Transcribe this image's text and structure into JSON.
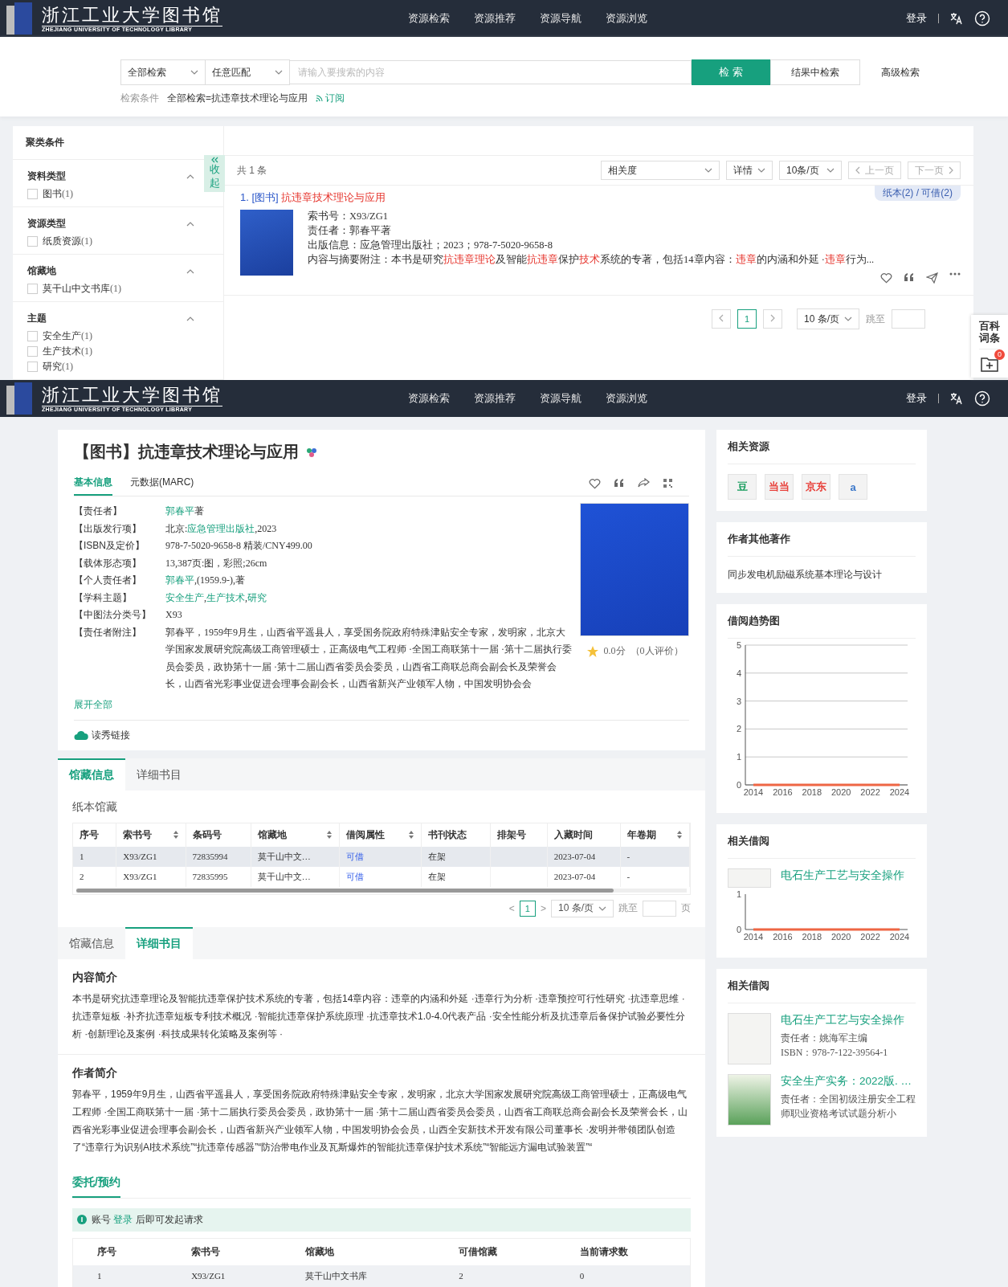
{
  "search_page": {
    "header": {
      "logo_title": "浙江工业大学图书馆",
      "logo_subtitle": "ZHEJIANG UNIVERSITY OF TECHNOLOGY LIBRARY",
      "nav": [
        "资源检索",
        "资源推荐",
        "资源导航",
        "资源浏览"
      ],
      "login": "登录"
    },
    "search": {
      "scope": "全部检索",
      "match": "任意匹配",
      "placeholder": "请输入要搜索的内容",
      "search_button": "检 索",
      "refine_button": "结果中检索",
      "advanced": "高级检索",
      "condition_label": "检索条件",
      "condition": "全部检索=抗违章技术理论与应用",
      "subscribe": "订阅"
    },
    "facets": {
      "title": "聚类条件",
      "collapse": "收起",
      "groups": [
        {
          "title": "资料类型",
          "expanded": true,
          "items": [
            {
              "label": "图书",
              "count": "(1)",
              "checked": false
            }
          ]
        },
        {
          "title": "资源类型",
          "expanded": true,
          "items": [
            {
              "label": "纸质资源",
              "count": "(1)",
              "checked": false
            }
          ]
        },
        {
          "title": "馆藏地",
          "expanded": true,
          "items": [
            {
              "label": "莫干山中文书库",
              "count": "(1)",
              "checked": false
            }
          ]
        },
        {
          "title": "主题",
          "expanded": true,
          "items": [
            {
              "label": "安全生产",
              "count": "(1)",
              "checked": false
            },
            {
              "label": "生产技术",
              "count": "(1)",
              "checked": false
            },
            {
              "label": "研究",
              "count": "(1)",
              "checked": false
            }
          ]
        }
      ]
    },
    "results": {
      "total": "共 1 条",
      "sort": "相关度",
      "view": "详情",
      "per_page": "10条/页",
      "prev": "上一页",
      "next": "下一页",
      "items": [
        {
          "number": "1.",
          "type": "[图书]",
          "title": "抗违章技术理论与应用",
          "availability": "纸本(2) / 可借(2)",
          "lines": [
            [
              {
                "t": "索书号：X93/ZG1"
              }
            ],
            [
              {
                "t": "责任者：郭春平著"
              }
            ],
            [
              {
                "t": "出版信息：应急管理出版社；2023；978-7-5020-9658-8"
              }
            ],
            [
              {
                "t": "内容与摘要附注：本书是研究"
              },
              {
                "t": "抗违章理论",
                "hl": true
              },
              {
                "t": "及智能"
              },
              {
                "t": "抗违章",
                "hl": true
              },
              {
                "t": "保护"
              },
              {
                "t": "技术",
                "hl": true
              },
              {
                "t": "系统的专著，包括14章内容："
              },
              {
                "t": "违章",
                "hl": true
              },
              {
                "t": "的内涵和外延 ·"
              },
              {
                "t": "违章",
                "hl": true
              },
              {
                "t": "行为..."
              }
            ]
          ]
        }
      ],
      "pagination": {
        "pages": [
          {
            "label": "1",
            "selected": true
          }
        ],
        "per_page": "10 条/页",
        "jump": "跳至"
      }
    },
    "side_widget": {
      "encyclopedia": "百科词条",
      "cart_count": "0"
    }
  },
  "detail_page": {
    "header": {
      "logo_title": "浙江工业大学图书馆",
      "logo_subtitle": "ZHEJIANG UNIVERSITY OF TECHNOLOGY LIBRARY",
      "nav": [
        "资源检索",
        "资源推荐",
        "资源导航",
        "资源浏览"
      ],
      "login": "登录"
    },
    "record": {
      "title": "【图书】抗违章技术理论与应用",
      "tabs": [
        {
          "label": "基本信息",
          "selected": true
        },
        {
          "label": "元数据(MARC)",
          "selected": false
        }
      ],
      "fields": [
        {
          "label": "【责任者】",
          "value": [
            {
              "t": "郭春平",
              "link": true
            },
            {
              "t": "著"
            }
          ]
        },
        {
          "label": "【出版发行项】",
          "value": [
            {
              "t": "北京:"
            },
            {
              "t": "应急管理出版社",
              "link": true
            },
            {
              "t": ",2023"
            }
          ]
        },
        {
          "label": "【ISBN及定价】",
          "value": [
            {
              "t": "978-7-5020-9658-8 精装/CNY499.00"
            }
          ]
        },
        {
          "label": "【载体形态项】",
          "value": [
            {
              "t": "13,387页:图，彩照;26cm"
            }
          ]
        },
        {
          "label": "【个人责任者】",
          "value": [
            {
              "t": "郭春平",
              "link": true
            },
            {
              "t": ",(1959.9-),著"
            }
          ]
        },
        {
          "label": "【学科主题】",
          "value": [
            {
              "t": "安全生产",
              "link": true
            },
            {
              "t": ","
            },
            {
              "t": "生产技术",
              "link": true
            },
            {
              "t": ","
            },
            {
              "t": "研究",
              "link": true
            }
          ]
        },
        {
          "label": "【中图法分类号】",
          "value": [
            {
              "t": "X93"
            }
          ]
        },
        {
          "label": "【责任者附注】",
          "value": [
            {
              "t": "郭春平，1959年9月生，山西省平遥县人，享受国务院政府特殊津贴安全专家，发明家，北京大学国家发展研究院高级工商管理硕士，正高级电气工程师 ·全国工商联第十一届 ·第十二届执行委员会委员，政协第十一届 ·第十二届山西省委员会委员，山西省工商联总商会副会长及荣誉会长，山西省光彩事业促进会理事会副会长，山西省新兴产业领军人物，中国发明协会会"
            }
          ]
        }
      ],
      "score": "0.0分",
      "rating_count": "（0人评价）",
      "expand": "展开全部",
      "read_link": "读秀链接"
    },
    "holdings": {
      "tabs": [
        {
          "label": "馆藏信息",
          "selected": true
        },
        {
          "label": "详细书目",
          "selected": false
        }
      ],
      "section": "纸本馆藏",
      "columns": [
        {
          "label": "序号",
          "sortable": false
        },
        {
          "label": "索书号",
          "sortable": true
        },
        {
          "label": "条码号",
          "sortable": false
        },
        {
          "label": "馆藏地",
          "sortable": true
        },
        {
          "label": "借阅属性",
          "sortable": true
        },
        {
          "label": "书刊状态",
          "sortable": false
        },
        {
          "label": "排架号",
          "sortable": false
        },
        {
          "label": "入藏时间",
          "sortable": false
        },
        {
          "label": "年卷期",
          "sortable": true
        }
      ],
      "rows": [
        {
          "selected": true,
          "cells": [
            "1",
            "X93/ZG1",
            "72835994",
            "莫干山中文…",
            "可借",
            "在架",
            null,
            "2023-07-04",
            "-"
          ]
        },
        {
          "selected": false,
          "cells": [
            "2",
            "X93/ZG1",
            "72835995",
            "莫干山中文…",
            "可借",
            "在架",
            null,
            "2023-07-04",
            "-"
          ]
        }
      ],
      "pagination": {
        "prev": "<",
        "pages": [
          {
            "label": "1",
            "selected": true
          }
        ],
        "next": ">",
        "per_page": "10 条/页",
        "jump": "跳至",
        "page_unit": "页"
      }
    },
    "bibliography": {
      "tabs": [
        {
          "label": "馆藏信息",
          "selected": false
        },
        {
          "label": "详细书目",
          "selected": true
        }
      ],
      "intro_title": "内容简介",
      "intro": "本书是研究抗违章理论及智能抗违章保护技术系统的专著，包括14章内容：违章的内涵和外延 ·违章行为分析 ·违章预控可行性研究 ·抗违章思维 ·抗违章短板 ·补齐抗违章短板专利技术概况 ·智能抗违章保护系统原理 ·抗违章技术1.0-4.0代表产品 ·安全性能分析及抗违章后备保护试验必要性分析 ·创新理论及案例 ·科技成果转化策略及案例等 ·",
      "author_title": "作者简介",
      "author": "郭春平，1959年9月生，山西省平遥县人，享受国务院政府特殊津贴安全专家，发明家，北京大学国家发展研究院高级工商管理硕士，正高级电气工程师 ·全国工商联第十一届 ·第十二届执行委员会委员，政协第十一届 ·第十二届山西省委员会委员，山西省工商联总商会副会长及荣誉会长，山西省光彩事业促进会理事会副会长，山西省新兴产业领军人物，中国发明协会会员，山西全安新技术开发有限公司董事长 ·发明并带领团队创造了“违章行为识别AI技术系统”“抗违章传感器”“防治带电作业及瓦斯爆炸的智能抗违章保护技术系统”“智能远方漏电试验装置”“"
    },
    "reserve": {
      "title": "委托/预约",
      "notice_before": "账号 ",
      "notice_link": "登录",
      "notice_after": " 后即可发起请求",
      "columns": [
        "序号",
        "索书号",
        "馆藏地",
        "可借馆藏",
        "当前请求数"
      ],
      "rows": [
        [
          "1",
          "X93/ZG1",
          "莫干山中文书库",
          "2",
          "0"
        ]
      ]
    },
    "sidebar": {
      "related_resources": {
        "title": "相关资源",
        "sources": [
          {
            "label": "豆",
            "color": "#1a9e5f"
          },
          {
            "label": "当当",
            "color": "#e8403a"
          },
          {
            "label": "京东",
            "color": "#e8403a"
          },
          {
            "label": "a",
            "color": "#3b77c9"
          }
        ]
      },
      "other_works": {
        "title": "作者其他著作",
        "items": [
          "同步发电机励磁系统基本理论与设计"
        ]
      },
      "trend": {
        "title": "借阅趋势图",
        "chart_data": {
          "type": "line",
          "categories": [
            "2014",
            "2016",
            "2018",
            "2020",
            "2022",
            "2024"
          ],
          "yticks": [
            0,
            1,
            2,
            3,
            4,
            5
          ],
          "ylim": [
            0,
            5
          ],
          "grid": true,
          "series": [
            {
              "color": "#ee6644",
              "values": [
                0,
                0,
                0,
                0,
                0,
                0
              ]
            }
          ]
        }
      },
      "related_partial": {
        "title": "相关借阅",
        "item": "电石生产工艺与安全操作",
        "chart_data": {
          "type": "line",
          "categories": [
            "2014",
            "2016",
            "2018",
            "2020",
            "2022",
            "2024"
          ],
          "yticks": [
            0,
            1
          ],
          "ylim": [
            0,
            1
          ],
          "series": [
            {
              "color": "#ee6644",
              "values": [
                0,
                0,
                0,
                0,
                0,
                0
              ]
            }
          ]
        }
      },
      "related": {
        "title": "相关借阅",
        "items": [
          {
            "title": "电石生产工艺与安全操作",
            "responsible": "责任者：姚海军主编",
            "isbn": "ISBN：978-7-122-39564-1"
          },
          {
            "title": "安全生产实务：2022版. …",
            "responsible": "责任者：全国初级注册安全工程师职业资格考试试题分析小"
          }
        ]
      }
    }
  }
}
